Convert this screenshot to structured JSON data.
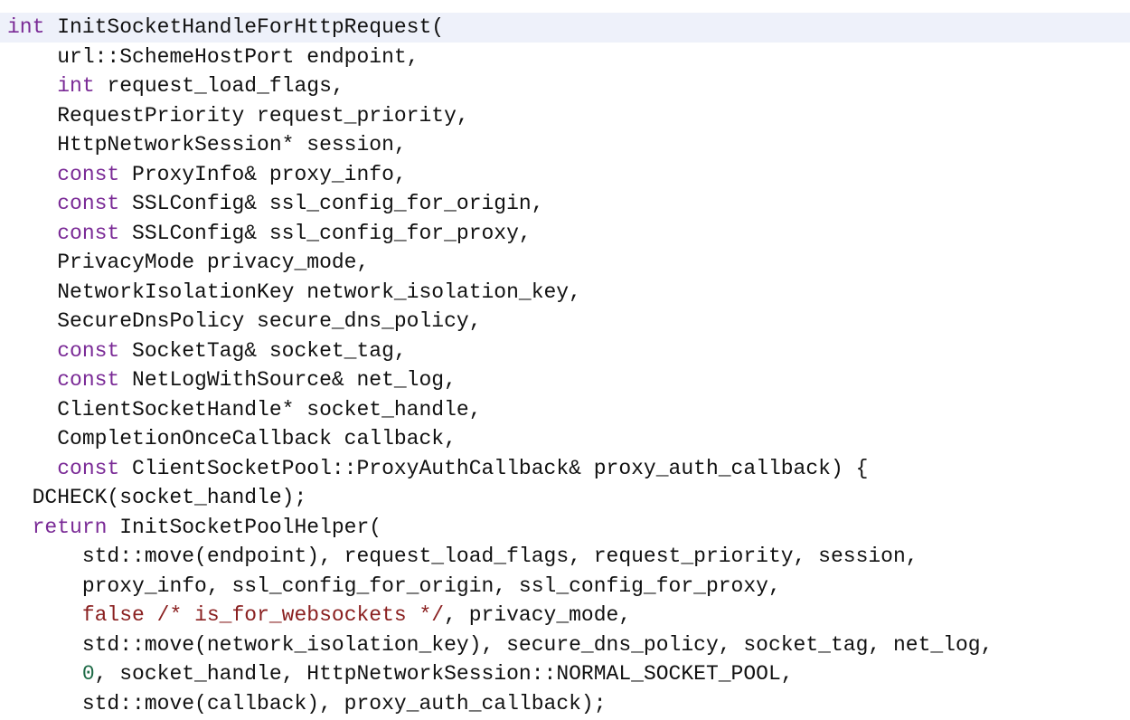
{
  "code": {
    "lines": [
      {
        "indent": "",
        "current": true,
        "tokens": [
          {
            "t": "kw",
            "s": "int"
          },
          {
            "t": "p",
            "s": " InitSocketHandleForHttpRequest("
          }
        ]
      },
      {
        "indent": "    ",
        "tokens": [
          {
            "t": "p",
            "s": "url::SchemeHostPort endpoint,"
          }
        ]
      },
      {
        "indent": "    ",
        "tokens": [
          {
            "t": "kw",
            "s": "int"
          },
          {
            "t": "p",
            "s": " request_load_flags,"
          }
        ]
      },
      {
        "indent": "    ",
        "tokens": [
          {
            "t": "p",
            "s": "RequestPriority request_priority,"
          }
        ]
      },
      {
        "indent": "    ",
        "tokens": [
          {
            "t": "p",
            "s": "HttpNetworkSession* session,"
          }
        ]
      },
      {
        "indent": "    ",
        "tokens": [
          {
            "t": "kw",
            "s": "const"
          },
          {
            "t": "p",
            "s": " ProxyInfo& proxy_info,"
          }
        ]
      },
      {
        "indent": "    ",
        "tokens": [
          {
            "t": "kw",
            "s": "const"
          },
          {
            "t": "p",
            "s": " SSLConfig& ssl_config_for_origin,"
          }
        ]
      },
      {
        "indent": "    ",
        "tokens": [
          {
            "t": "kw",
            "s": "const"
          },
          {
            "t": "p",
            "s": " SSLConfig& ssl_config_for_proxy,"
          }
        ]
      },
      {
        "indent": "    ",
        "tokens": [
          {
            "t": "p",
            "s": "PrivacyMode privacy_mode,"
          }
        ]
      },
      {
        "indent": "    ",
        "tokens": [
          {
            "t": "p",
            "s": "NetworkIsolationKey network_isolation_key,"
          }
        ]
      },
      {
        "indent": "    ",
        "tokens": [
          {
            "t": "p",
            "s": "SecureDnsPolicy secure_dns_policy,"
          }
        ]
      },
      {
        "indent": "    ",
        "tokens": [
          {
            "t": "kw",
            "s": "const"
          },
          {
            "t": "p",
            "s": " SocketTag& socket_tag,"
          }
        ]
      },
      {
        "indent": "    ",
        "tokens": [
          {
            "t": "kw",
            "s": "const"
          },
          {
            "t": "p",
            "s": " NetLogWithSource& net_log,"
          }
        ]
      },
      {
        "indent": "    ",
        "tokens": [
          {
            "t": "p",
            "s": "ClientSocketHandle* socket_handle,"
          }
        ]
      },
      {
        "indent": "    ",
        "tokens": [
          {
            "t": "p",
            "s": "CompletionOnceCallback callback,"
          }
        ]
      },
      {
        "indent": "    ",
        "tokens": [
          {
            "t": "kw",
            "s": "const"
          },
          {
            "t": "p",
            "s": " ClientSocketPool::ProxyAuthCallback& proxy_auth_callback) {"
          }
        ]
      },
      {
        "indent": "  ",
        "tokens": [
          {
            "t": "p",
            "s": "DCHECK(socket_handle);"
          }
        ]
      },
      {
        "indent": "  ",
        "tokens": [
          {
            "t": "kw",
            "s": "return"
          },
          {
            "t": "p",
            "s": " InitSocketPoolHelper("
          }
        ]
      },
      {
        "indent": "      ",
        "tokens": [
          {
            "t": "p",
            "s": "std::move(endpoint), request_load_flags, request_priority, session,"
          }
        ]
      },
      {
        "indent": "      ",
        "tokens": [
          {
            "t": "p",
            "s": "proxy_info, ssl_config_for_origin, ssl_config_for_proxy,"
          }
        ]
      },
      {
        "indent": "      ",
        "tokens": [
          {
            "t": "lit",
            "s": "false"
          },
          {
            "t": "p",
            "s": " "
          },
          {
            "t": "cm",
            "s": "/* is_for_websockets */"
          },
          {
            "t": "p",
            "s": ", privacy_mode,"
          }
        ]
      },
      {
        "indent": "      ",
        "tokens": [
          {
            "t": "p",
            "s": "std::move(network_isolation_key), secure_dns_policy, socket_tag, net_log,"
          }
        ]
      },
      {
        "indent": "      ",
        "tokens": [
          {
            "t": "num",
            "s": "0"
          },
          {
            "t": "p",
            "s": ", socket_handle, HttpNetworkSession::NORMAL_SOCKET_POOL,"
          }
        ]
      },
      {
        "indent": "      ",
        "tokens": [
          {
            "t": "p",
            "s": "std::move(callback), proxy_auth_callback);"
          }
        ]
      }
    ]
  },
  "colors": {
    "keyword": "#7a2a96",
    "literal": "#8a2020",
    "comment": "#8a2020",
    "number": "#1d6a46",
    "text": "#111111",
    "current_line_bg": "#eef1fa"
  }
}
